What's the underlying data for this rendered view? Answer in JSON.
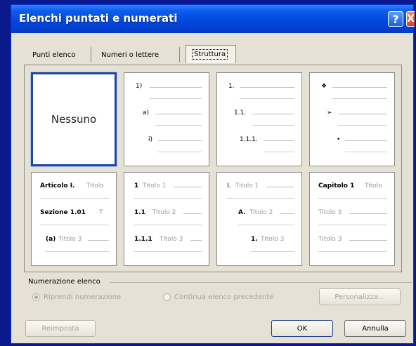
{
  "dialog": {
    "title": "Elenchi puntati e numerati",
    "help_label": "?",
    "close_label": "X"
  },
  "tabs": [
    {
      "label": "Punti elenco"
    },
    {
      "label": "Numeri o lettere"
    },
    {
      "label": "Struttura"
    }
  ],
  "grid": {
    "none_label": "Nessuno",
    "c2": [
      "1)",
      "a)",
      "i)"
    ],
    "c3": [
      "1.",
      "1.1.",
      "1.1.1."
    ],
    "c4": [
      "❖",
      "➢",
      "•"
    ],
    "c5": [
      {
        "num": "Articolo I.",
        "text": "Titolo"
      },
      {
        "num": "Sezione 1.01",
        "text": "T"
      },
      {
        "num": "(a)",
        "text": "Titolo 3"
      }
    ],
    "c6": [
      {
        "num": "1",
        "text": "Titolo 1"
      },
      {
        "num": "1.1",
        "text": "Titolo 2"
      },
      {
        "num": "1.1.1",
        "text": "Titolo 3"
      }
    ],
    "c7": [
      {
        "num": "I.",
        "text": "Titolo 1"
      },
      {
        "num": "A.",
        "text": "Titolo 2"
      },
      {
        "num": "1.",
        "text": "Titolo 3"
      }
    ],
    "c8": [
      {
        "num": "Capitolo 1",
        "text": "Titolo"
      },
      {
        "num": "",
        "text": "Titolo 3"
      },
      {
        "num": "",
        "text": "Titolo 3"
      }
    ]
  },
  "numbering": {
    "section_label": "Numerazione elenco",
    "restart_label": "Riprendi numerazione",
    "continue_label": "Continua elenco precedente",
    "customize_label": "Personalizza..."
  },
  "footer": {
    "reset_label": "Reimposta",
    "ok_label": "OK",
    "cancel_label": "Annulla"
  }
}
